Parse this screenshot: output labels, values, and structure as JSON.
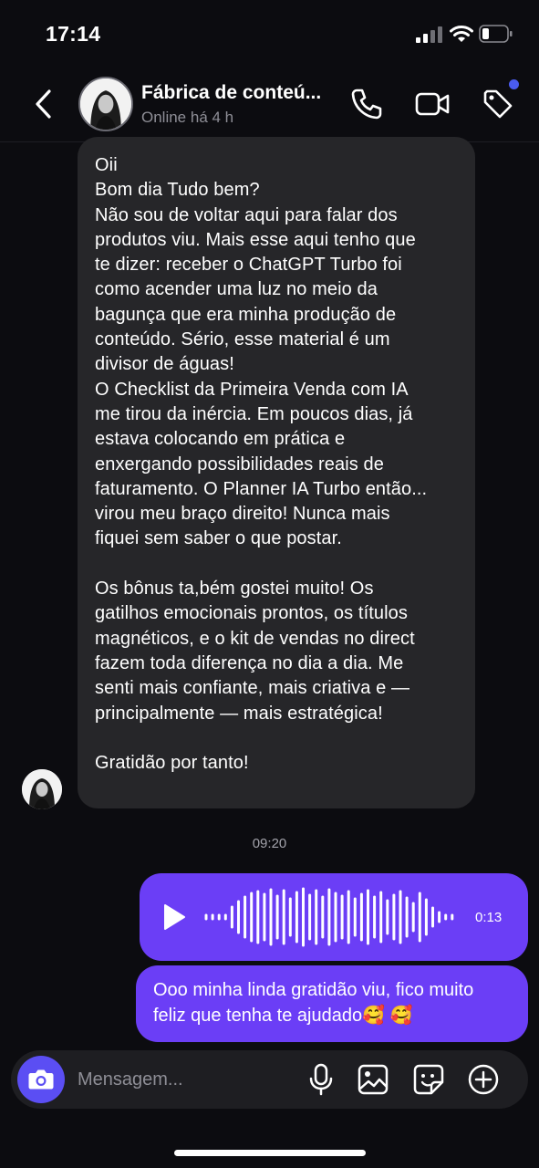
{
  "status_bar": {
    "time": "17:14"
  },
  "header": {
    "name": "Fábrica de conteú...",
    "status": "Online há 4 h"
  },
  "messages": {
    "incoming": {
      "text": "Oii\nBom dia Tudo bem?\nNão sou de voltar aqui para falar dos\nprodutos viu. Mais esse aqui tenho que\nte dizer: receber o ChatGPT Turbo foi\ncomo acender uma luz no meio da\nbagunça que era minha produção de\nconteúdo. Sério, esse material é um\ndivisor de águas!\nO Checklist da Primeira Venda com IA\nme tirou da inércia. Em poucos dias, já\nestava colocando em prática e\nenxergando possibilidades reais de\nfaturamento. O Planner IA Turbo então...\nvirou meu braço direito! Nunca mais\nfiquei sem saber o que postar.\n\nOs bônus ta,bém gostei muito! Os\ngatilhos emocionais prontos, os títulos\nmagnéticos, e o kit de vendas no direct\nfazem toda diferença no dia a dia. Me\nsenti mais confiante, mais criativa e —\nprincipalmente — mais estratégica!\n\nGratidão por tanto!"
    },
    "timestamp": "09:20",
    "voice": {
      "duration": "0:13"
    },
    "outgoing": {
      "text": "Ooo minha linda gratidão viu, fico muito\nfeliz que tenha te ajudado🥰 🥰"
    }
  },
  "composer": {
    "placeholder": "Mensagem..."
  },
  "colors": {
    "background": "#0c0c10",
    "incoming_bubble": "#262629",
    "outgoing_bubble": "#6b3ef6",
    "camera_button": "#5b4ef3",
    "notification_dot": "#4a5cf0"
  },
  "icons": [
    "back-icon",
    "phone-icon",
    "video-camera-icon",
    "tag-icon",
    "play-icon",
    "camera-icon",
    "microphone-icon",
    "gallery-icon",
    "sticker-icon",
    "plus-icon"
  ]
}
